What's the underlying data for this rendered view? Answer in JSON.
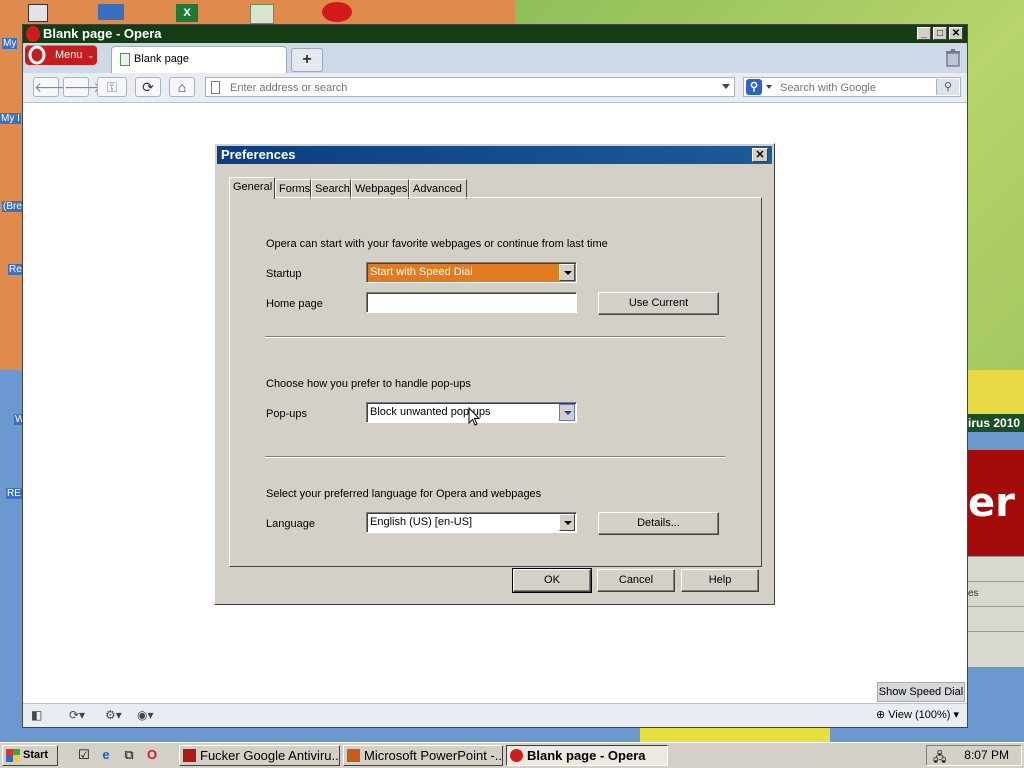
{
  "desktop": {
    "labels": [
      "My",
      "My I",
      "(Bre",
      "Re",
      "W",
      "RE"
    ],
    "antivirus_title": "irus 2010",
    "antivirus_red_text": "er",
    "antivirus_row_text": "es"
  },
  "opera": {
    "title": "Blank page - Opera",
    "menu_label": "Menu",
    "tab_label": "Blank page",
    "new_tab_symbol": "+",
    "address_placeholder": "Enter address or search",
    "search_placeholder": "Search with Google",
    "speed_dial_label": "Show Speed Dial",
    "zoom_label": "View (100%)"
  },
  "dialog": {
    "title": "Preferences",
    "tabs": [
      "General",
      "Forms",
      "Search",
      "Webpages",
      "Advanced"
    ],
    "startup_intro": "Opera can start with your favorite webpages or continue from last time",
    "startup_label": "Startup",
    "startup_value": "Start with Speed Dial",
    "homepage_label": "Home page",
    "homepage_value": "",
    "use_current_label": "Use Current",
    "popup_intro": "Choose how you prefer to handle pop-ups",
    "popups_label": "Pop-ups",
    "popups_value": "Block unwanted pop-ups",
    "language_intro": "Select your preferred language for Opera and webpages",
    "language_label": "Language",
    "language_value": "English (US) [en-US]",
    "details_label": "Details...",
    "ok_label": "OK",
    "cancel_label": "Cancel",
    "help_label": "Help"
  },
  "taskbar": {
    "start_label": "Start",
    "tasks": [
      "Fucker Google Antiviru...",
      "Microsoft PowerPoint -...",
      "Blank page - Opera"
    ],
    "clock": "8:07 PM"
  },
  "colors": {
    "startup_highlight": "#e07b1f",
    "dialog_title": "#0a3f7f",
    "opera_title": "#153d14",
    "opera_red": "#c41d1d"
  }
}
